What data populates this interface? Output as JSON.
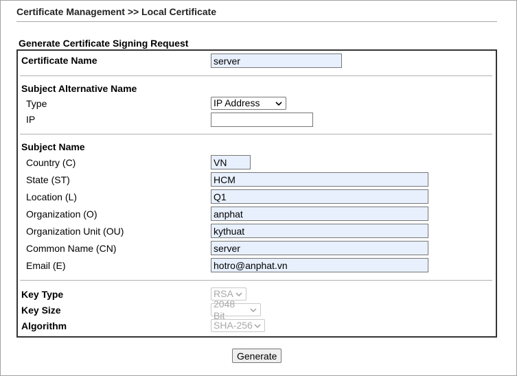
{
  "header": {
    "title": "Certificate Management >> Local Certificate"
  },
  "section": {
    "title": "Generate Certificate Signing Request"
  },
  "certificate_name": {
    "label": "Certificate Name",
    "value": "server"
  },
  "san": {
    "title": "Subject Alternative Name",
    "type_label": "Type",
    "type_value": "IP Address",
    "ip_label": "IP",
    "ip_value": ""
  },
  "subject": {
    "title": "Subject Name",
    "fields": [
      {
        "label": "Country (C)",
        "value": "VN"
      },
      {
        "label": "State (ST)",
        "value": "HCM"
      },
      {
        "label": "Location (L)",
        "value": "Q1"
      },
      {
        "label": "Organization (O)",
        "value": "anphat"
      },
      {
        "label": "Organization Unit (OU)",
        "value": "kythuat"
      },
      {
        "label": "Common Name (CN)",
        "value": "server"
      },
      {
        "label": "Email (E)",
        "value": "hotro@anphat.vn"
      }
    ]
  },
  "key": {
    "type_label": "Key Type",
    "type_value": "RSA",
    "size_label": "Key Size",
    "size_value": "2048 Bit",
    "algo_label": "Algorithm",
    "algo_value": "SHA-256"
  },
  "actions": {
    "generate_label": "Generate"
  },
  "icons": {
    "dropdown": "chevron-down-icon"
  }
}
